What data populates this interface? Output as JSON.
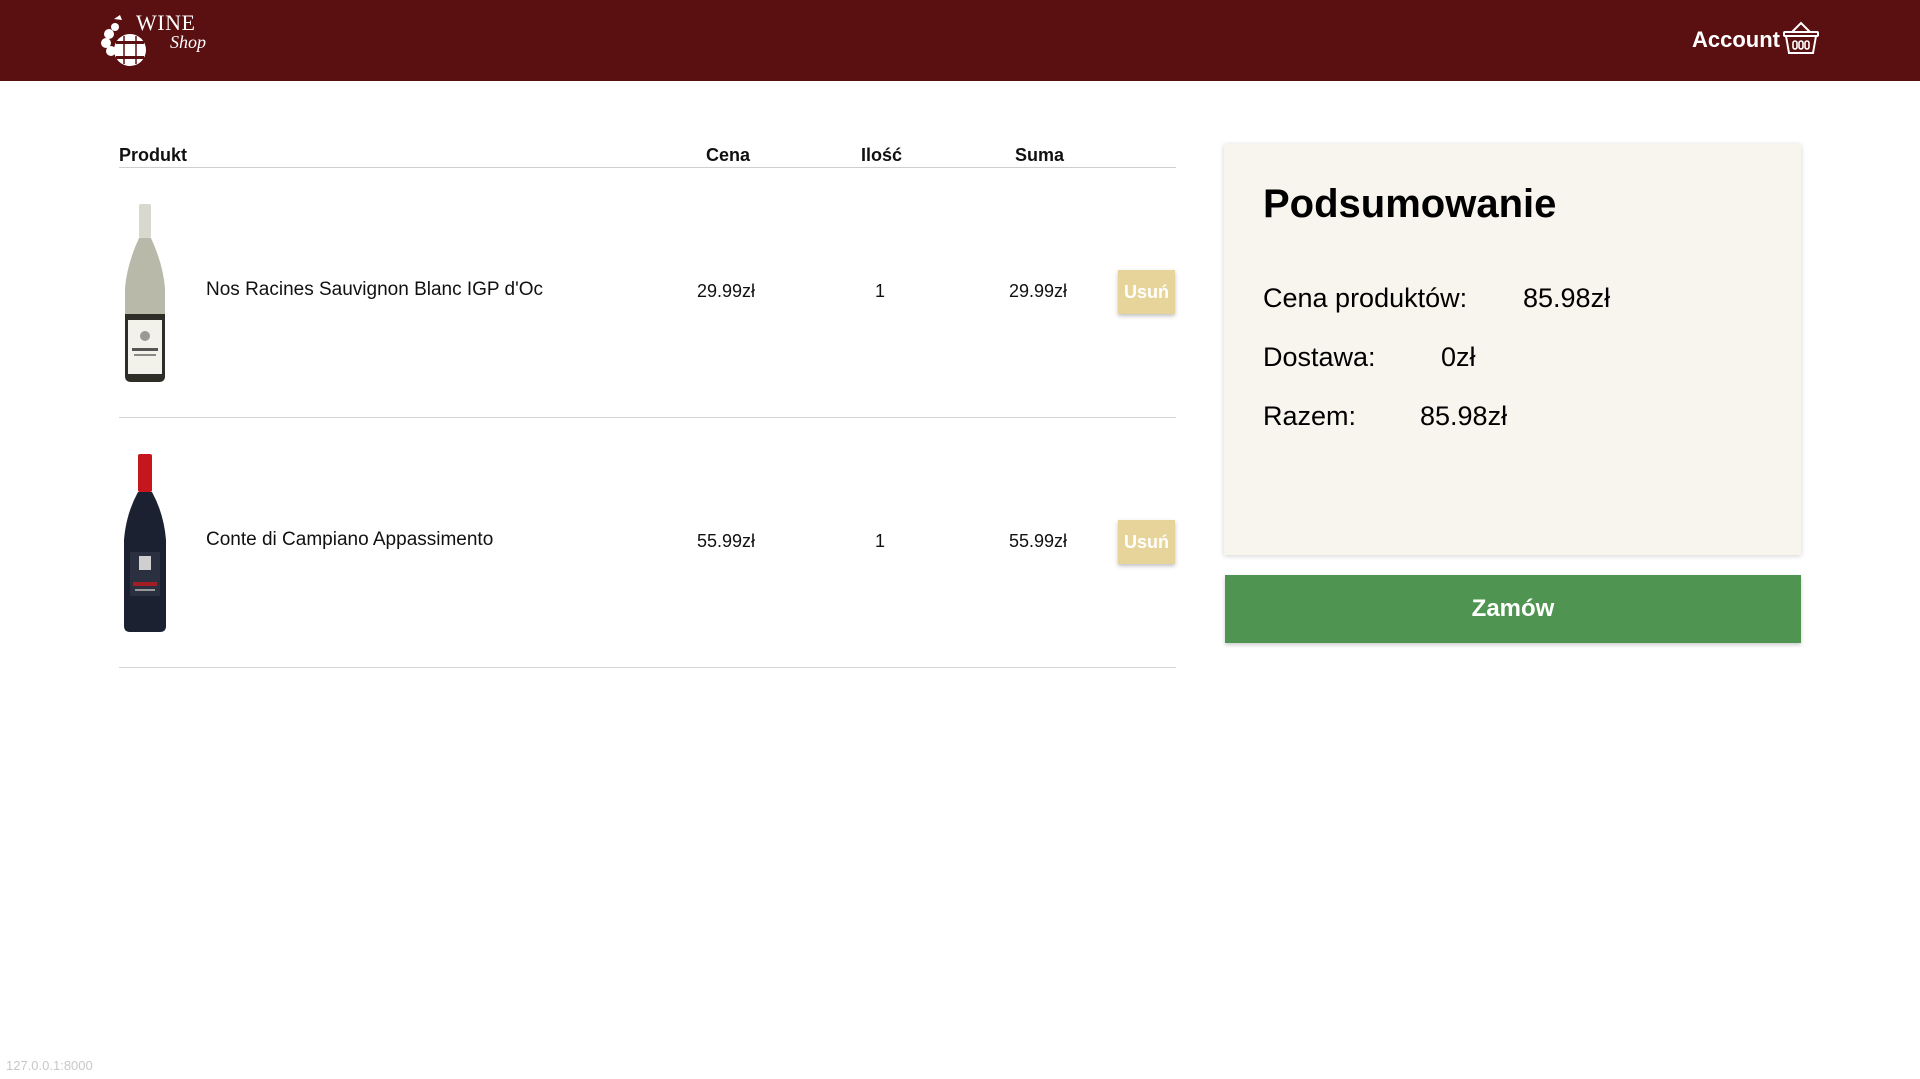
{
  "header": {
    "logo_word": "WINE",
    "logo_sub": "Shop",
    "account_label": "Account",
    "basket_icon": "basket-icon",
    "background_color": "#5a0f10"
  },
  "cart": {
    "columns": {
      "product": "Produkt",
      "price": "Cena",
      "quantity": "Ilość",
      "sum": "Suma"
    },
    "items": [
      {
        "name": "Nos Racines Sauvignon Blanc IGP d'Oc",
        "price": "29.99zł",
        "quantity": "1",
        "sum": "29.99zł",
        "remove_label": "Usuń"
      },
      {
        "name": "Conte di Campiano Appassimento",
        "price": "55.99zł",
        "quantity": "1",
        "sum": "55.99zł",
        "remove_label": "Usuń"
      }
    ]
  },
  "summary": {
    "title": "Podsumowanie",
    "products_label": "Cena produktów:",
    "products_value": "85.98zł",
    "delivery_label": "Dostawa:",
    "delivery_value": "0zł",
    "total_label": "Razem:",
    "total_value": "85.98zł"
  },
  "order_button_label": "Zamów",
  "status_url": "127.0.0.1:8000",
  "colors": {
    "remove_button": "#e6d49a",
    "order_button": "#4f9450",
    "summary_bg": "#f8f4ee"
  }
}
